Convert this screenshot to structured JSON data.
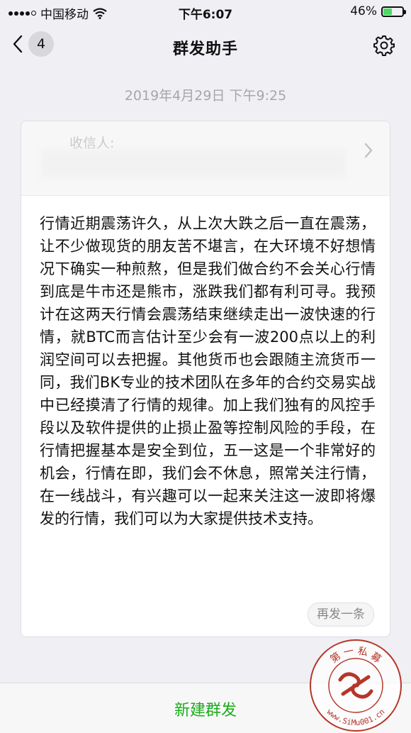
{
  "status_bar": {
    "carrier": "中国移动",
    "time": "下午6:07",
    "battery_percent": "46%",
    "battery_level": 0.46,
    "icons": [
      "signal-icon",
      "wifi-icon",
      "battery-icon"
    ]
  },
  "nav": {
    "back_count": "4",
    "title": "群发助手",
    "icons": [
      "back-chevron-icon",
      "gear-icon"
    ]
  },
  "timestamp": "2019年4月29日 下午9:25",
  "card": {
    "recipients_label": "收信人:",
    "message": "行情近期震荡许久，从上次大跌之后一直在震荡，让不少做现货的朋友苦不堪言，在大环境不好想情况下确实一种煎熬，但是我们做合约不会关心行情到底是牛市还是熊市，涨跌我们都有利可寻。我预计在这两天行情会震荡结束继续走出一波快速的行情，就BTC而言估计至少会有一波200点以上的利润空间可以去把握。其他货币也会跟随主流货币一同，我们BK专业的技术团队在多年的合约交易实战中已经摸清了行情的规律。加上我们独有的风控手段以及软件提供的止损止盈等控制风险的手段，在行情把握基本是安全到位，五一这是一个非常好的机会，行情在即，我们会不休息，照常关注行情，在一线战斗，有兴趣可以一起来关注这一波即将爆发的行情，我们可以为大家提供技术支持。",
    "resend_label": "再发一条"
  },
  "bottom": {
    "new_label": "新建群发"
  },
  "watermark": {
    "top_text": "第 一 私 募",
    "bottom_text": "www.SiMu001.cn"
  },
  "colors": {
    "accent_green": "#1aad19",
    "background": "#efeff4",
    "watermark_red": "#b5362a"
  }
}
